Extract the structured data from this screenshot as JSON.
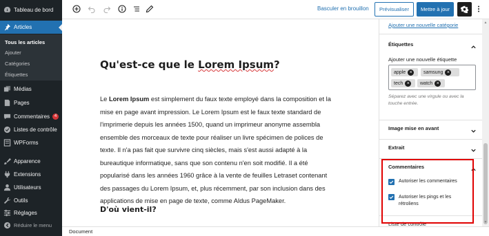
{
  "sidebar": {
    "dashboard": "Tableau de bord",
    "articles": "Articles",
    "submenu": [
      "Tous les articles",
      "Ajouter",
      "Catégories",
      "Étiquettes"
    ],
    "medias": "Médias",
    "pages": "Pages",
    "comments": "Commentaires",
    "comments_count": "4",
    "checklists": "Listes de contrôle",
    "wpforms": "WPForms",
    "appearance": "Apparence",
    "extensions": "Extensions",
    "users": "Utilisateurs",
    "tools": "Outils",
    "settings": "Réglages",
    "collapse": "Réduire le menu"
  },
  "toolbar": {
    "add_icon": "plus-circle-icon",
    "undo_icon": "undo-icon",
    "redo_icon": "redo-icon",
    "info_icon": "info-icon",
    "list_view_icon": "list-view-icon",
    "tools_icon": "pencil-icon",
    "switch_draft": "Basculer en brouillon",
    "preview": "Prévisualiser",
    "update": "Mettre à jour",
    "settings_icon": "gear-icon",
    "more_icon": "vertical-ellipsis-icon"
  },
  "editor": {
    "title_prefix": "Qu'est-ce que le ",
    "title_spell": "Lorem Ipsum",
    "title_suffix": "?",
    "para_lead": "Le ",
    "para_bold": "Lorem Ipsum",
    "para_rest": " est simplement du faux texte employé dans la composition et la mise en page avant impression. Le Lorem Ipsum est le faux texte standard de l'imprimerie depuis les années 1500, quand un imprimeur anonyme assembla ensemble des morceaux de texte pour réaliser un livre spécimen de polices de texte. Il n'a pas fait que survivre cinq siècles, mais s'est aussi adapté à la bureautique informatique, sans que son contenu n'en soit modifié. Il a été popularisé dans les années 1960 grâce à la vente de feuilles Letraset contenant des passages du Lorem Ipsum, et, plus récemment, par son inclusion dans des applications de mise en page de texte, comme Aldus PageMaker.",
    "heading2": "D'où vient-il?"
  },
  "footer": {
    "breadcrumb": "Document"
  },
  "settings_panel": {
    "add_category": "Ajouter une nouvelle catégorie",
    "tags_title": "Étiquettes",
    "tags_label": "Ajouter une nouvelle étiquette",
    "tags": [
      "apple",
      "samsung",
      "tech",
      "watch"
    ],
    "tags_help": "Séparez avec une virgule ou avec la touche entrée.",
    "featured_image": "Image mise en avant",
    "excerpt": "Extrait",
    "comments_title": "Commentaires",
    "allow_comments": "Autoriser les commentaires",
    "allow_pings": "Autoriser les pings et les rétroliens",
    "checklist_partial": "Liste de contrôle"
  },
  "colors": {
    "accent": "#2271b1",
    "sidebar_bg": "#1d2327",
    "highlight": "#e00000"
  }
}
